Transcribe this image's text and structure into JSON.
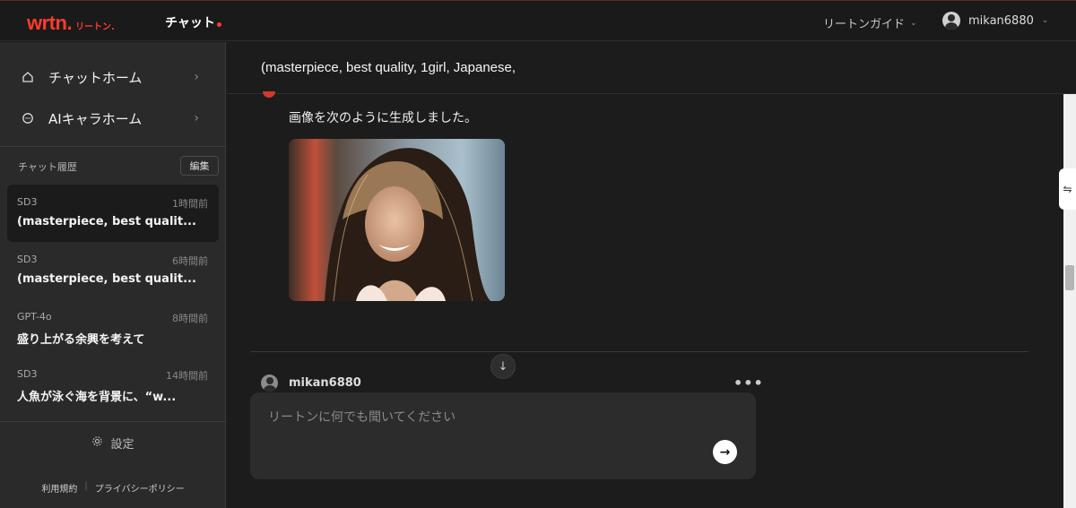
{
  "header": {
    "logo_main": "wrtn.",
    "logo_sub": "リートン.",
    "page_title": "チャット",
    "guide_label": "リートンガイド",
    "username": "mikan6880"
  },
  "sidebar": {
    "nav": [
      {
        "label": "チャットホーム",
        "icon": "home-icon"
      },
      {
        "label": "AIキャラホーム",
        "icon": "chat-bubble-icon"
      }
    ],
    "history_label": "チャット履歴",
    "edit_label": "編集",
    "history": [
      {
        "model": "SD3",
        "time": "1時間前",
        "title": "(masterpiece, best qualit..."
      },
      {
        "model": "SD3",
        "time": "6時間前",
        "title": "(masterpiece, best qualit..."
      },
      {
        "model": "GPT-4o",
        "time": "8時間前",
        "title": "盛り上がる余興を考えて"
      },
      {
        "model": "SD3",
        "time": "14時間前",
        "title": "人魚が泳ぐ海を背景に、“w..."
      }
    ],
    "settings_label": "設定",
    "footer": {
      "terms": "利用規約",
      "sep": "|",
      "privacy": "プライバシーポリシー"
    }
  },
  "main": {
    "chat_title": "(masterpiece, best quality, 1girl, Japanese,",
    "assistant_message": "画像を次のように生成しました。",
    "user_name": "mikan6880",
    "input_placeholder": "リートンに何でも聞いてください"
  },
  "colors": {
    "brand": "#ff3b2f",
    "background": "#1c1c1c",
    "sidebar": "#2a2a2a"
  }
}
